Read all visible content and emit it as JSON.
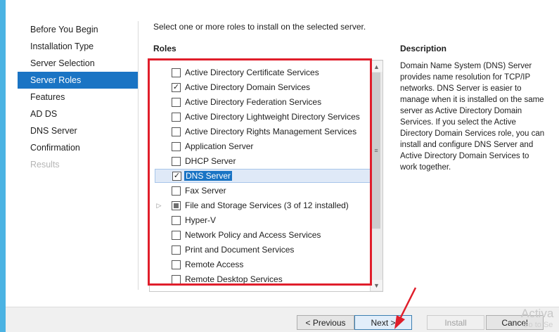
{
  "nav": {
    "items": [
      {
        "label": "Before You Begin",
        "state": "normal"
      },
      {
        "label": "Installation Type",
        "state": "normal"
      },
      {
        "label": "Server Selection",
        "state": "normal"
      },
      {
        "label": "Server Roles",
        "state": "active"
      },
      {
        "label": "Features",
        "state": "normal"
      },
      {
        "label": "AD DS",
        "state": "normal"
      },
      {
        "label": "DNS Server",
        "state": "normal"
      },
      {
        "label": "Confirmation",
        "state": "normal"
      },
      {
        "label": "Results",
        "state": "disabled"
      }
    ]
  },
  "instruction": "Select one or more roles to install on the selected server.",
  "roles": {
    "heading": "Roles",
    "items": [
      {
        "label": "Active Directory Certificate Services",
        "checked": false
      },
      {
        "label": "Active Directory Domain Services",
        "checked": true
      },
      {
        "label": "Active Directory Federation Services",
        "checked": false
      },
      {
        "label": "Active Directory Lightweight Directory Services",
        "checked": false
      },
      {
        "label": "Active Directory Rights Management Services",
        "checked": false
      },
      {
        "label": "Application Server",
        "checked": false
      },
      {
        "label": "DHCP Server",
        "checked": false
      },
      {
        "label": "DNS Server",
        "checked": true,
        "selected": true
      },
      {
        "label": "Fax Server",
        "checked": false
      },
      {
        "label": "File and Storage Services (3 of 12 installed)",
        "checked": "partial",
        "expandable": true
      },
      {
        "label": "Hyper-V",
        "checked": false
      },
      {
        "label": "Network Policy and Access Services",
        "checked": false
      },
      {
        "label": "Print and Document Services",
        "checked": false
      },
      {
        "label": "Remote Access",
        "checked": false
      },
      {
        "label": "Remote Desktop Services",
        "checked": false
      }
    ]
  },
  "description": {
    "heading": "Description",
    "text": "Domain Name System (DNS) Server provides name resolution for TCP/IP networks. DNS Server is easier to manage when it is installed on the same server as Active Directory Domain Services. If you select the Active Directory Domain Services role, you can install and configure DNS Server and Active Directory Domain Services to work together."
  },
  "buttons": {
    "previous": "< Previous",
    "next": "Next >",
    "install": "Install",
    "cancel": "Cancel"
  },
  "watermark": {
    "line1": "Activa",
    "line2": "Go to Se"
  },
  "colors": {
    "accent": "#1a74c4",
    "annotation": "#e01e2b",
    "background": "#4bb3e3"
  }
}
